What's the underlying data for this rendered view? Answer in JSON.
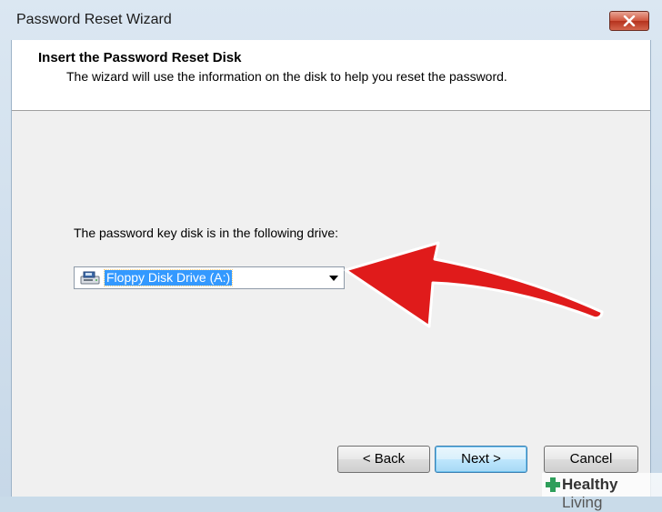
{
  "window": {
    "title": "Password Reset Wizard"
  },
  "header": {
    "title": "Insert the Password Reset Disk",
    "subtitle": "The wizard will use the information on the disk to help you reset the password."
  },
  "drive": {
    "label": "The password key disk is in the following drive:",
    "selected": "Floppy Disk Drive (A:)"
  },
  "buttons": {
    "back": "< Back",
    "next": "Next >",
    "cancel": "Cancel"
  },
  "watermark": {
    "brand_bold": "Healthy",
    "brand_light": " Living"
  },
  "colors": {
    "selection": "#3399ff",
    "annotation_arrow": "#e01b1b",
    "brand_green": "#2e9e5a"
  }
}
